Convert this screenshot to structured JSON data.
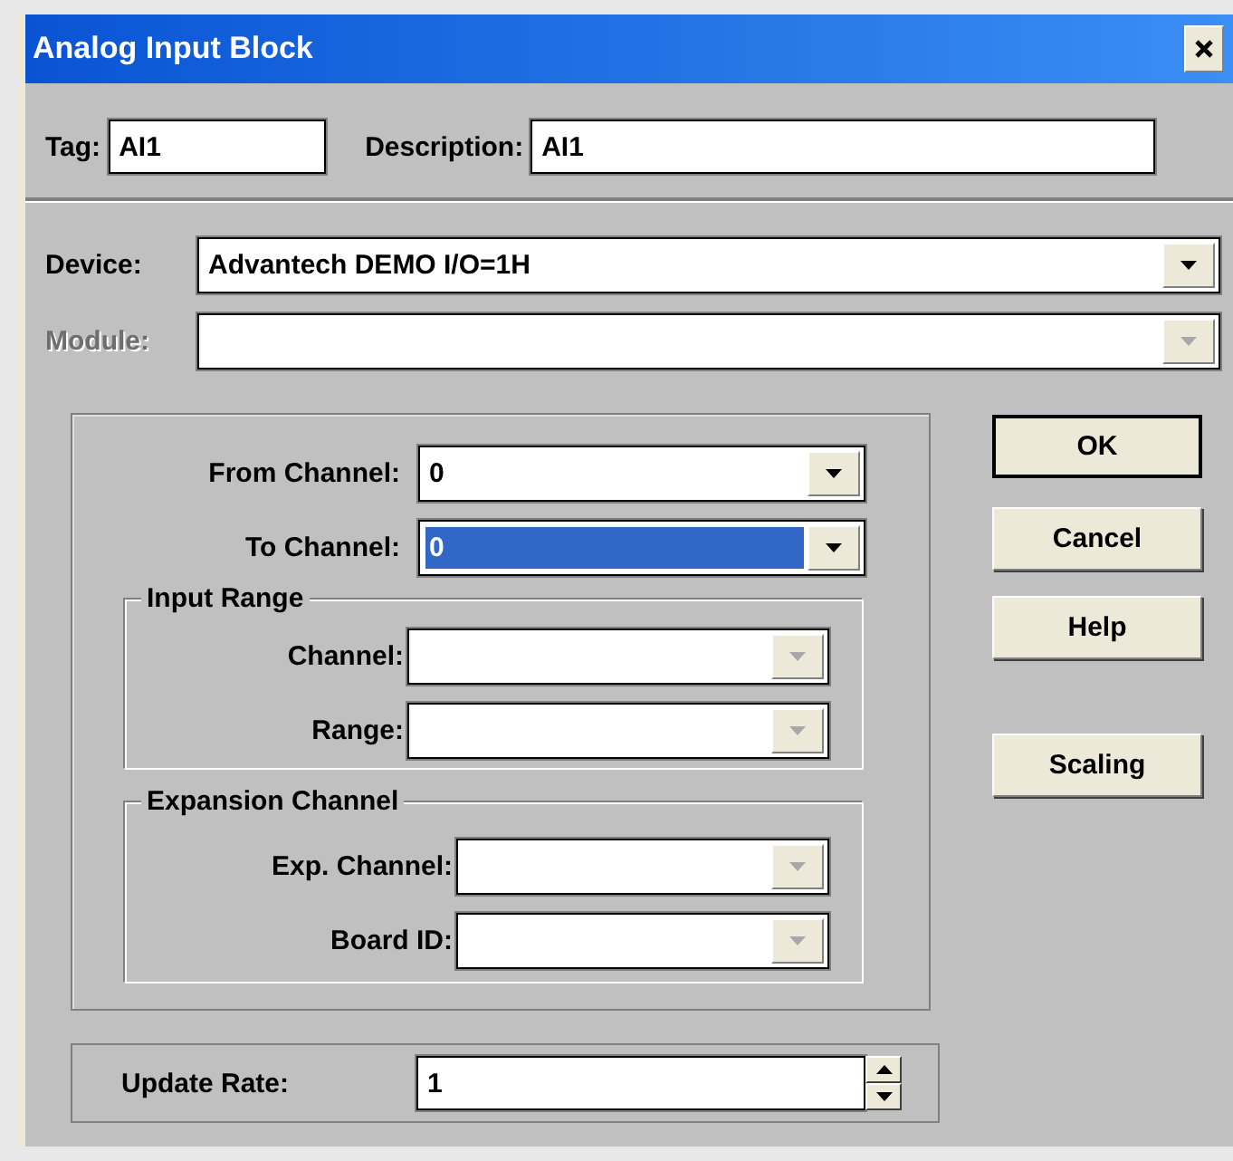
{
  "window": {
    "title": "Analog Input Block"
  },
  "header_fields": [
    {
      "label": "Tag:",
      "value": "AI1"
    },
    {
      "label": "Description:",
      "value": "AI1"
    }
  ],
  "selectors": [
    {
      "label": "Device:",
      "value": "Advantech DEMO I/O=1H",
      "disabled": false
    },
    {
      "label": "Module:",
      "disabled": true
    }
  ],
  "channels": [
    {
      "label": "From Channel:",
      "value": "0",
      "focused": false
    },
    {
      "label": "To Channel:",
      "value": "0",
      "focused": true
    }
  ],
  "groups": [
    {
      "title": "Input Range",
      "fields": [
        {
          "label": "Channel:",
          "disabled": true
        },
        {
          "label": "Range:",
          "disabled": true
        }
      ]
    },
    {
      "title": "Expansion Channel",
      "fields": [
        {
          "label": "Exp. Channel:",
          "disabled": true
        },
        {
          "label": "Board ID:",
          "disabled": true
        }
      ]
    }
  ],
  "update_rate": {
    "label": "Update Rate:",
    "value": "1"
  },
  "buttons": [
    {
      "label": "OK",
      "default": true
    },
    {
      "label": "Cancel",
      "default": false
    },
    {
      "label": "Help",
      "default": false
    },
    {
      "label": "Scaling",
      "default": false
    }
  ]
}
